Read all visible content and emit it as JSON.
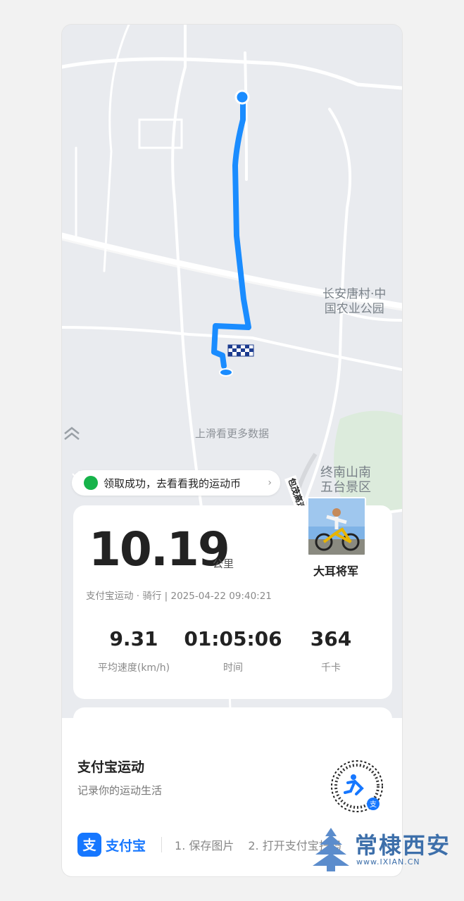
{
  "map": {
    "labels": {
      "park": "长安唐村·中\n国农业公园",
      "scenic": "终南山南\n五台景区",
      "road": "包茂高速"
    },
    "swipe_hint": "上滑看更多数据"
  },
  "toast": {
    "text": "领取成功，去看看我的运动币"
  },
  "activity": {
    "distance": "10.19",
    "distance_unit": "公里",
    "meta": "支付宝运动 · 骑行 | 2025-04-22 09:40:21",
    "user_name": "大耳将军",
    "metrics": [
      {
        "value": "9.31",
        "label": "平均速度(km/h)"
      },
      {
        "value": "01:05:06",
        "label": "时间"
      },
      {
        "value": "364",
        "label": "千卡"
      }
    ]
  },
  "footer": {
    "title": "支付宝运动",
    "subtitle": "记录你的运动生活",
    "brand": "支付宝",
    "step1": "1. 保存图片",
    "step2": "2. 打开支付宝扫码"
  },
  "watermark": {
    "text": "常棣西安",
    "url": "www.IXIAN.CN"
  },
  "colors": {
    "route": "#1a8cff",
    "success": "#16b34a",
    "alipay_blue": "#1677ff"
  }
}
